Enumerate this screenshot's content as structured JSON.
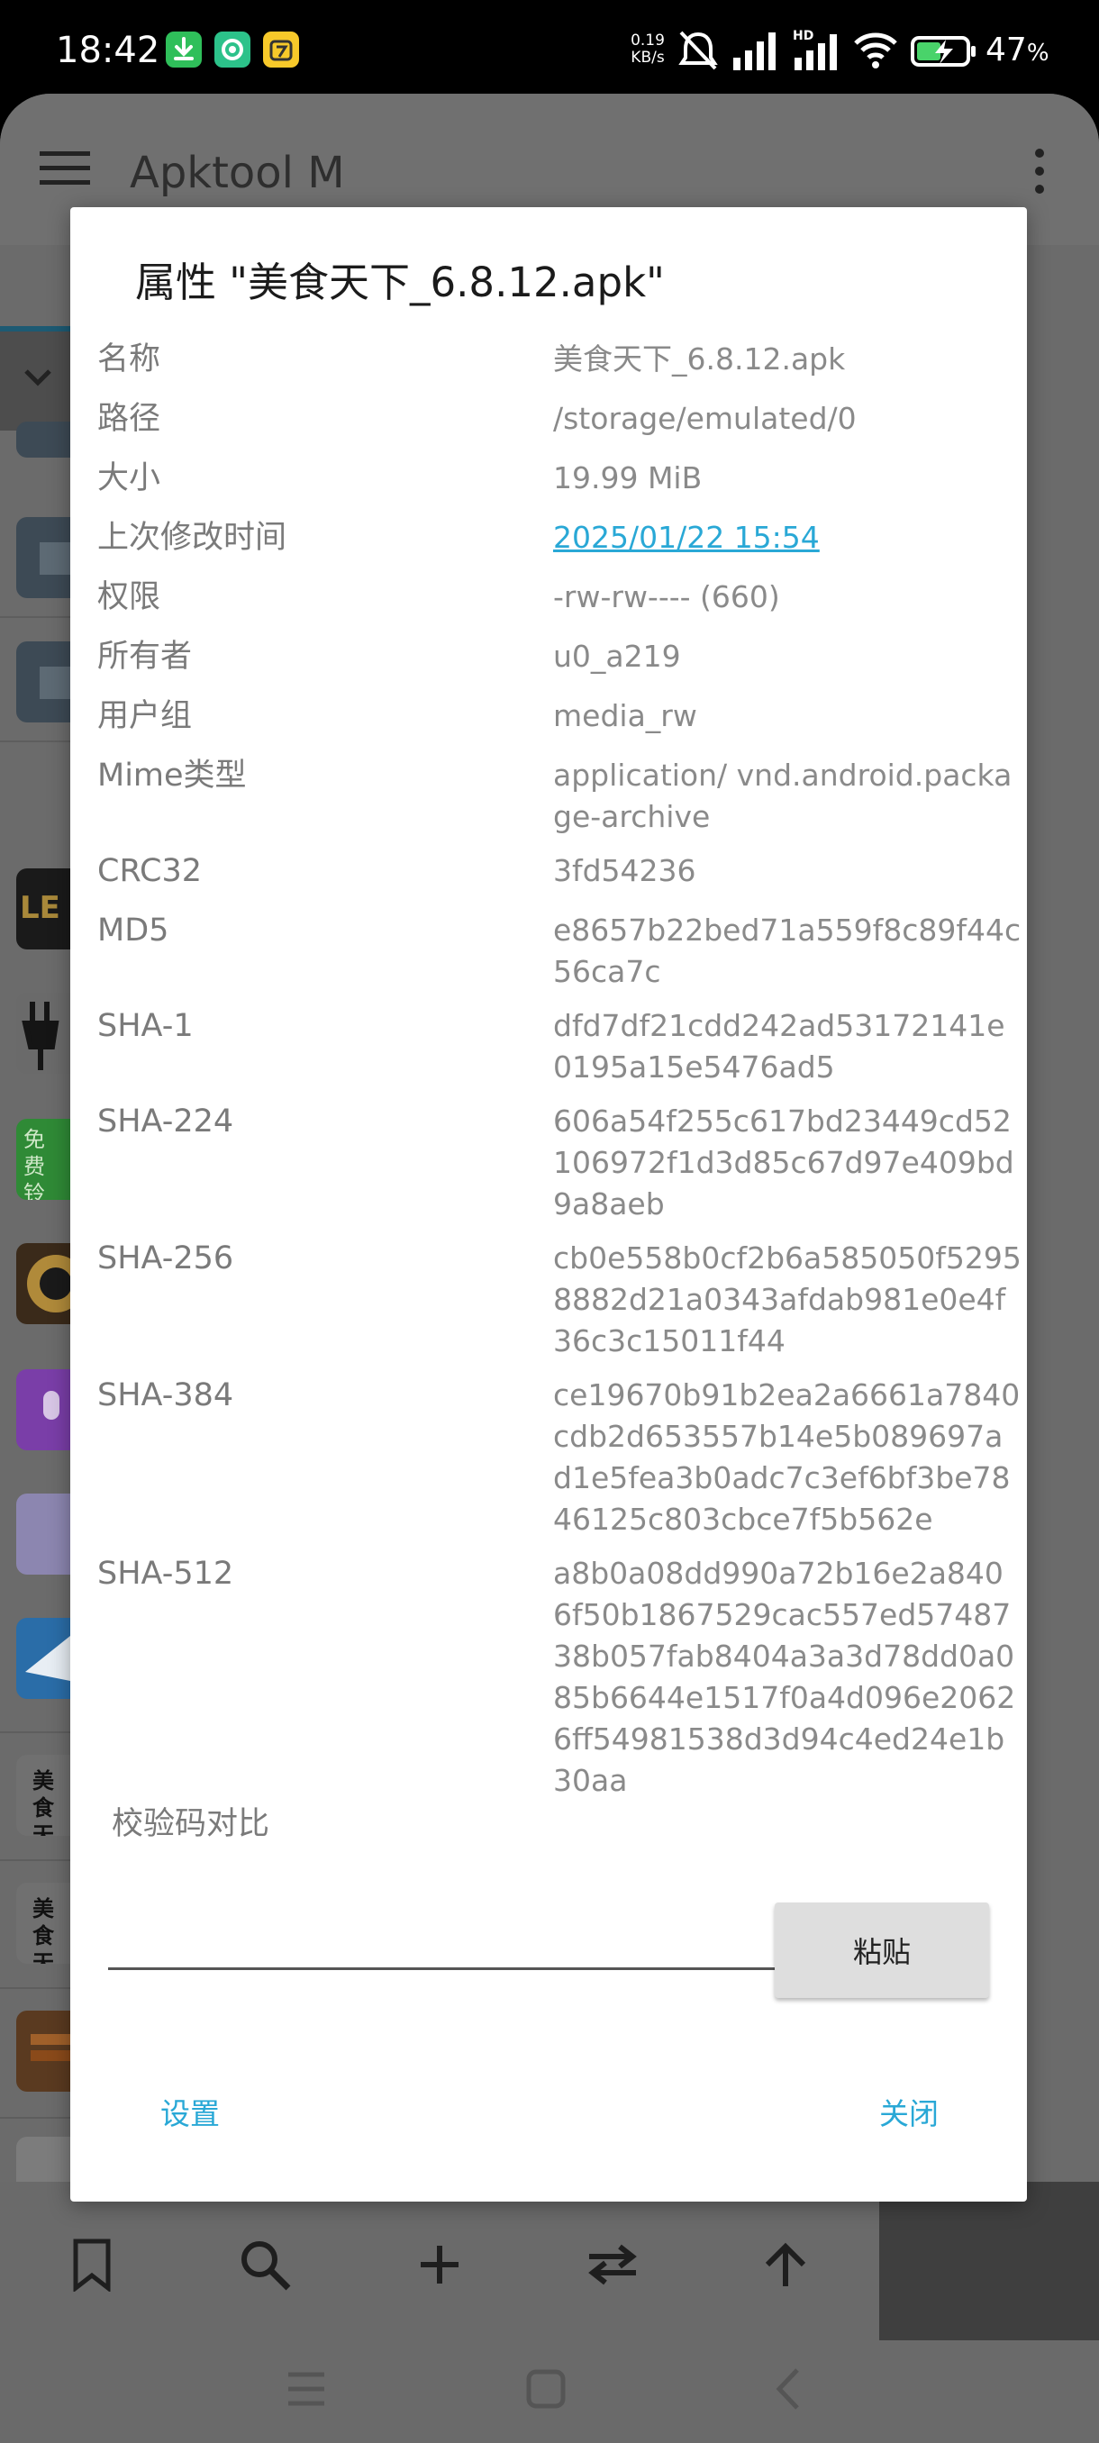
{
  "status_bar": {
    "time": "18:42",
    "speed_value": "0.19",
    "speed_unit": "KB/s",
    "battery_percent": "47",
    "battery_unit": "%",
    "icons": [
      "download-app-icon",
      "green-app-icon",
      "yellow-app-icon",
      "alarm-off-icon",
      "signal-icon",
      "hd-signal-icon",
      "wifi-icon",
      "battery-charging-icon"
    ]
  },
  "app": {
    "title": "Apktool M",
    "toolbar_icons": [
      "bookmark-icon",
      "search-icon",
      "add-icon",
      "swap-icon",
      "arrow-up-icon"
    ],
    "nav_icons": [
      "recents-icon",
      "home-icon",
      "back-icon"
    ],
    "thumb_text_1": "LE",
    "thumb_text_2": "免费铃声",
    "thumb_text_3": "美食天下",
    "thumb_text_4": "美食天下"
  },
  "dialog": {
    "title": "属性 \"美食天下_6.8.12.apk\"",
    "rows": [
      {
        "label": "名称",
        "value": "美食天下_6.8.12.apk"
      },
      {
        "label": "路径",
        "value": "/storage/emulated/0"
      },
      {
        "label": "大小",
        "value": "19.99 MiB"
      },
      {
        "label": "上次修改时间",
        "value": "2025/01/22 15:54"
      },
      {
        "label": "权限",
        "value": "-rw-rw---- (660)"
      },
      {
        "label": "所有者",
        "value": "u0_a219"
      },
      {
        "label": "用户组",
        "value": "media_rw"
      },
      {
        "label": "Mime类型",
        "value": "application/ vnd.android.package-archive"
      },
      {
        "label": "CRC32",
        "value": "3fd54236"
      },
      {
        "label": "MD5",
        "value": "e8657b22bed71a559f8c89f44c56ca7c"
      },
      {
        "label": "SHA-1",
        "value": "dfd7df21cdd242ad53172141e0195a15e5476ad5"
      },
      {
        "label": "SHA-224",
        "value": "606a54f255c617bd23449cd52106972f1d3d85c67d97e409bd9a8aeb"
      },
      {
        "label": "SHA-256",
        "value": "cb0e558b0cf2b6a585050f52958882d21a0343afdab981e0e4f36c3c15011f44"
      },
      {
        "label": "SHA-384",
        "value": "ce19670b91b2ea2a6661a7840cdb2d653557b14e5b089697ad1e5fea3b0adc7c3ef6bf3be7846125c803cbce7f5b562e"
      },
      {
        "label": "SHA-512",
        "value": "a8b0a08dd990a72b16e2a8406f50b1867529cac557ed5748738b057fab8404a3a3d78dd0a085b6644e1517f0a4d096e20626ff54981538d3d94c4ed24e1b30aa"
      }
    ],
    "verify_label": "校验码对比",
    "verify_input_value": "",
    "paste_label": "粘贴",
    "settings_label": "设置",
    "close_label": "关闭"
  },
  "colors": {
    "accent": "#29a8d6",
    "dim_overlay": "#6b6b6b",
    "dialog_bg": "#ffffff"
  }
}
